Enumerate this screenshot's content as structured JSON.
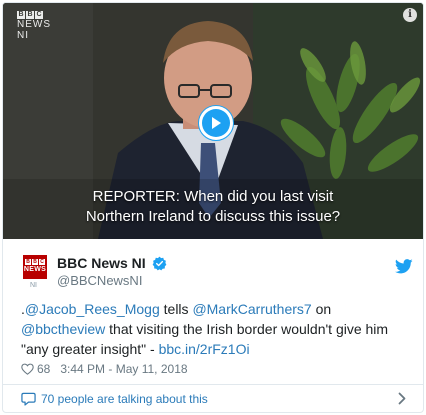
{
  "video": {
    "watermark": {
      "blocks": [
        "B",
        "B",
        "C"
      ],
      "line2": "NEWS",
      "line3": "NI"
    },
    "info_glyph": "i",
    "subtitle_line1": "REPORTER: When did you last visit",
    "subtitle_line2": "Northern Ireland to discuss this issue?"
  },
  "author": {
    "avatar_blocks": [
      "B",
      "B",
      "C"
    ],
    "avatar_word": "NEWS",
    "avatar_region": "NI",
    "display_name": "BBC News NI",
    "handle": "@BBCNewsNI",
    "verified": true
  },
  "tweet": {
    "t0": ".",
    "m1": "@Jacob_Rees_Mogg",
    "t1": " tells ",
    "m2": "@MarkCarruthers7",
    "t2": " on ",
    "m3": "@bbctheview",
    "t3": " that visiting the Irish border wouldn't give him \"any greater insight\" - ",
    "link": "bbc.in/2rFz1Oi"
  },
  "meta": {
    "likes": "68",
    "timestamp": "3:44 PM - May 11, 2018"
  },
  "footer": {
    "talking_text": "70 people are talking about this"
  },
  "colors": {
    "link": "#2b7bb9",
    "twitter_blue": "#1da1f2",
    "bbc_red": "#b80000",
    "muted": "#697882"
  }
}
